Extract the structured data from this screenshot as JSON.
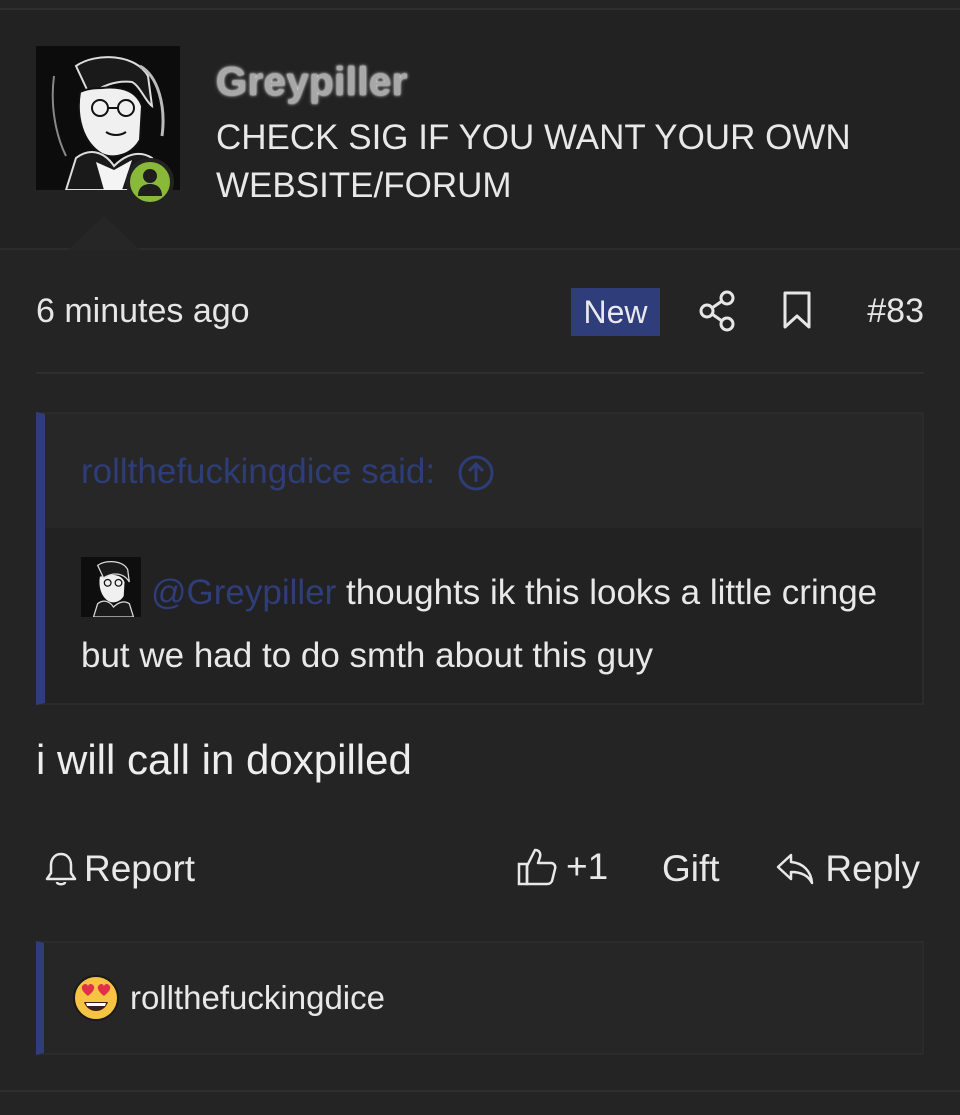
{
  "author": {
    "username": "Greypiller",
    "title": "CHECK SIG IF YOU WANT YOUR OWN WEBSITE/FORUM",
    "online": true
  },
  "meta": {
    "time": "6 minutes ago",
    "badge": "New",
    "post_number": "#83"
  },
  "quote": {
    "header": "rollthefuckingdice said:",
    "mention": "@Greypiller",
    "text": " thoughts ik this looks a little cringe but we had to do smth about this guy"
  },
  "message": "i will call in doxpilled",
  "actions": {
    "report": "Report",
    "like_count": "+1",
    "gift": "Gift",
    "reply": "Reply"
  },
  "reactions": {
    "user": "rollthefuckingdice",
    "emoji": "heart-eyes-icon"
  },
  "colors": {
    "accent": "#2f3d7a",
    "online": "#8ab93a",
    "background": "#242424"
  }
}
